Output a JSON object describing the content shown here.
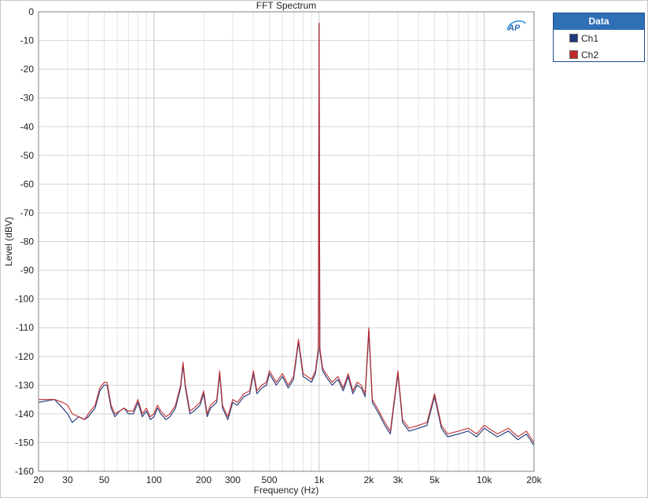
{
  "chart_data": {
    "type": "line",
    "title": "FFT Spectrum",
    "xlabel": "Frequency (Hz)",
    "ylabel": "Level (dBV)",
    "xscale": "log",
    "xlim": [
      20,
      20000
    ],
    "ylim": [
      -160,
      0
    ],
    "x_ticks": [
      20,
      30,
      50,
      100,
      200,
      300,
      500,
      1000,
      2000,
      3000,
      5000,
      10000,
      20000
    ],
    "x_tick_labels": [
      "20",
      "30",
      "50",
      "100",
      "200",
      "300",
      "500",
      "1k",
      "2k",
      "3k",
      "5k",
      "10k",
      "20k"
    ],
    "y_ticks": [
      0,
      -10,
      -20,
      -30,
      -40,
      -50,
      -60,
      -70,
      -80,
      -90,
      -100,
      -110,
      -120,
      -130,
      -140,
      -150,
      -160
    ],
    "y_tick_labels": [
      "0",
      "-10",
      "-20",
      "-30",
      "-40",
      "-50",
      "-60",
      "-70",
      "-80",
      "-90",
      "-100",
      "-110",
      "-120",
      "-130",
      "-140",
      "-150",
      "-160"
    ],
    "grid": true,
    "legend_position": "right-outside",
    "legend_title": "Data",
    "series": [
      {
        "name": "Ch1",
        "color": "#1f3a7a",
        "points": [
          [
            20,
            -136
          ],
          [
            25,
            -135
          ],
          [
            28,
            -138
          ],
          [
            30,
            -140
          ],
          [
            32,
            -143
          ],
          [
            35,
            -141
          ],
          [
            38,
            -142
          ],
          [
            40,
            -141
          ],
          [
            44,
            -138
          ],
          [
            47,
            -132
          ],
          [
            50,
            -130
          ],
          [
            52,
            -130
          ],
          [
            55,
            -138
          ],
          [
            58,
            -141
          ],
          [
            62,
            -139
          ],
          [
            66,
            -138
          ],
          [
            70,
            -140
          ],
          [
            75,
            -140
          ],
          [
            80,
            -136
          ],
          [
            85,
            -141
          ],
          [
            90,
            -139
          ],
          [
            95,
            -142
          ],
          [
            100,
            -141
          ],
          [
            105,
            -138
          ],
          [
            110,
            -140
          ],
          [
            118,
            -142
          ],
          [
            125,
            -141
          ],
          [
            135,
            -138
          ],
          [
            145,
            -131
          ],
          [
            150,
            -123
          ],
          [
            155,
            -131
          ],
          [
            165,
            -140
          ],
          [
            175,
            -139
          ],
          [
            190,
            -137
          ],
          [
            200,
            -133
          ],
          [
            210,
            -141
          ],
          [
            220,
            -138
          ],
          [
            240,
            -136
          ],
          [
            250,
            -126
          ],
          [
            260,
            -138
          ],
          [
            280,
            -142
          ],
          [
            300,
            -136
          ],
          [
            320,
            -137
          ],
          [
            350,
            -134
          ],
          [
            380,
            -133
          ],
          [
            400,
            -126
          ],
          [
            420,
            -133
          ],
          [
            450,
            -131
          ],
          [
            480,
            -130
          ],
          [
            500,
            -126
          ],
          [
            550,
            -130
          ],
          [
            600,
            -127
          ],
          [
            650,
            -131
          ],
          [
            700,
            -128
          ],
          [
            750,
            -115
          ],
          [
            800,
            -127
          ],
          [
            850,
            -128
          ],
          [
            900,
            -129
          ],
          [
            950,
            -126
          ],
          [
            990,
            -118
          ],
          [
            1000,
            -4
          ],
          [
            1010,
            -118
          ],
          [
            1050,
            -125
          ],
          [
            1100,
            -127
          ],
          [
            1200,
            -130
          ],
          [
            1300,
            -128
          ],
          [
            1400,
            -132
          ],
          [
            1500,
            -127
          ],
          [
            1600,
            -133
          ],
          [
            1700,
            -130
          ],
          [
            1800,
            -131
          ],
          [
            1900,
            -134
          ],
          [
            2000,
            -111
          ],
          [
            2100,
            -136
          ],
          [
            2300,
            -140
          ],
          [
            2500,
            -144
          ],
          [
            2700,
            -147
          ],
          [
            3000,
            -126
          ],
          [
            3200,
            -143
          ],
          [
            3500,
            -146
          ],
          [
            4000,
            -145
          ],
          [
            4500,
            -144
          ],
          [
            5000,
            -134
          ],
          [
            5500,
            -145
          ],
          [
            6000,
            -148
          ],
          [
            7000,
            -147
          ],
          [
            8000,
            -146
          ],
          [
            9000,
            -148
          ],
          [
            10000,
            -145
          ],
          [
            12000,
            -148
          ],
          [
            14000,
            -146
          ],
          [
            16000,
            -149
          ],
          [
            18000,
            -147
          ],
          [
            20000,
            -151
          ]
        ]
      },
      {
        "name": "Ch2",
        "color": "#c0282a",
        "points": [
          [
            20,
            -135
          ],
          [
            25,
            -135
          ],
          [
            28,
            -136
          ],
          [
            30,
            -137
          ],
          [
            32,
            -140
          ],
          [
            35,
            -141
          ],
          [
            38,
            -142
          ],
          [
            40,
            -140
          ],
          [
            44,
            -137
          ],
          [
            47,
            -131
          ],
          [
            50,
            -129
          ],
          [
            52,
            -129
          ],
          [
            55,
            -137
          ],
          [
            58,
            -140
          ],
          [
            62,
            -139
          ],
          [
            66,
            -138
          ],
          [
            70,
            -139
          ],
          [
            75,
            -139
          ],
          [
            80,
            -135
          ],
          [
            85,
            -140
          ],
          [
            90,
            -138
          ],
          [
            95,
            -141
          ],
          [
            100,
            -140
          ],
          [
            105,
            -137
          ],
          [
            110,
            -139
          ],
          [
            118,
            -141
          ],
          [
            125,
            -140
          ],
          [
            135,
            -137
          ],
          [
            145,
            -130
          ],
          [
            150,
            -122
          ],
          [
            155,
            -130
          ],
          [
            165,
            -139
          ],
          [
            175,
            -138
          ],
          [
            190,
            -136
          ],
          [
            200,
            -132
          ],
          [
            210,
            -140
          ],
          [
            220,
            -137
          ],
          [
            240,
            -135
          ],
          [
            250,
            -125
          ],
          [
            260,
            -137
          ],
          [
            280,
            -141
          ],
          [
            300,
            -135
          ],
          [
            320,
            -136
          ],
          [
            350,
            -133
          ],
          [
            380,
            -132
          ],
          [
            400,
            -125
          ],
          [
            420,
            -132
          ],
          [
            450,
            -130
          ],
          [
            480,
            -129
          ],
          [
            500,
            -125
          ],
          [
            550,
            -129
          ],
          [
            600,
            -126
          ],
          [
            650,
            -130
          ],
          [
            700,
            -127
          ],
          [
            750,
            -114
          ],
          [
            800,
            -126
          ],
          [
            850,
            -127
          ],
          [
            900,
            -128
          ],
          [
            950,
            -125
          ],
          [
            990,
            -117
          ],
          [
            1000,
            -4
          ],
          [
            1010,
            -117
          ],
          [
            1050,
            -124
          ],
          [
            1100,
            -126
          ],
          [
            1200,
            -129
          ],
          [
            1300,
            -127
          ],
          [
            1400,
            -131
          ],
          [
            1500,
            -126
          ],
          [
            1600,
            -132
          ],
          [
            1700,
            -129
          ],
          [
            1800,
            -130
          ],
          [
            1900,
            -133
          ],
          [
            2000,
            -110
          ],
          [
            2100,
            -135
          ],
          [
            2300,
            -139
          ],
          [
            2500,
            -143
          ],
          [
            2700,
            -146
          ],
          [
            3000,
            -125
          ],
          [
            3200,
            -142
          ],
          [
            3500,
            -145
          ],
          [
            4000,
            -144
          ],
          [
            4500,
            -143
          ],
          [
            5000,
            -133
          ],
          [
            5500,
            -144
          ],
          [
            6000,
            -147
          ],
          [
            7000,
            -146
          ],
          [
            8000,
            -145
          ],
          [
            9000,
            -147
          ],
          [
            10000,
            -144
          ],
          [
            12000,
            -147
          ],
          [
            14000,
            -145
          ],
          [
            16000,
            -148
          ],
          [
            18000,
            -146
          ],
          [
            20000,
            -150
          ]
        ]
      }
    ],
    "annotations": [
      "AP"
    ]
  }
}
